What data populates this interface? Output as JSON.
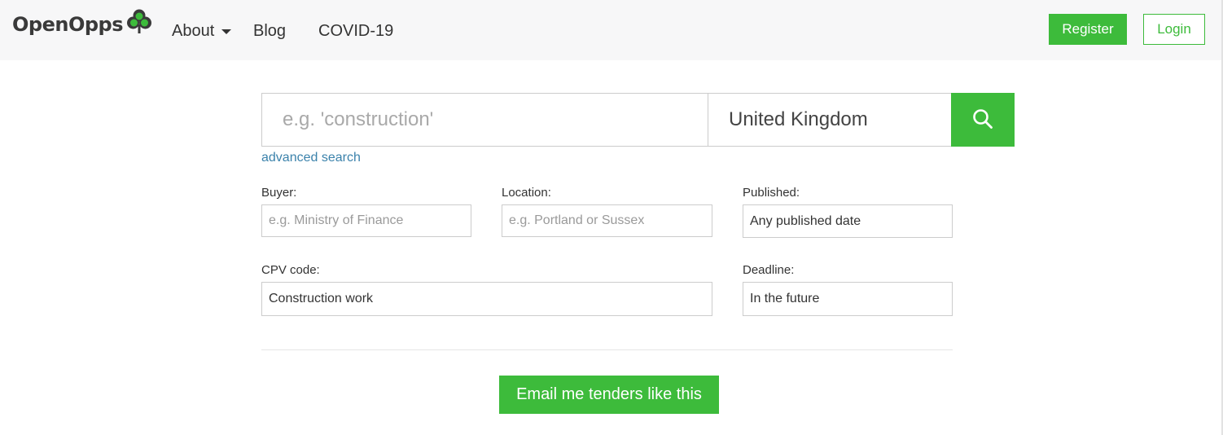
{
  "header": {
    "logo_text": "OpenOpps",
    "nav": {
      "about": "About",
      "blog": "Blog",
      "covid": "COVID-19"
    },
    "register_label": "Register",
    "login_label": "Login"
  },
  "search": {
    "keyword_placeholder": "e.g. 'construction'",
    "country_value": "United Kingdom",
    "advanced_label": "advanced search"
  },
  "filters": {
    "buyer": {
      "label": "Buyer:",
      "placeholder": "e.g. Ministry of Finance"
    },
    "location": {
      "label": "Location:",
      "placeholder": "e.g. Portland or Sussex"
    },
    "published": {
      "label": "Published:",
      "value": "Any published date"
    },
    "cpv": {
      "label": "CPV code:",
      "value": "Construction work"
    },
    "deadline": {
      "label": "Deadline:",
      "value": "In the future"
    }
  },
  "email_button_label": "Email me tenders like this",
  "colors": {
    "brand_green": "#3dbb3b",
    "link_blue": "#3b82ab",
    "header_bg": "#f7f7f8"
  },
  "icons": {
    "logo": "clover-icon",
    "search": "search-icon",
    "about_caret": "caret-down-icon"
  }
}
